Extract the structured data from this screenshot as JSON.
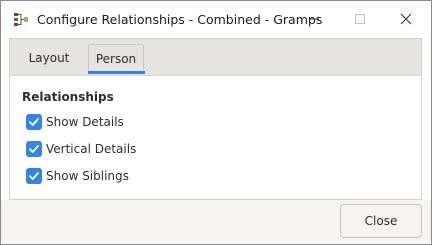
{
  "window": {
    "title": "Configure Relationships - Combined - Gramps",
    "app_icon": "gramps-tree-icon",
    "controls": {
      "minimize_icon": "minimize-icon",
      "maximize_icon": "maximize-icon",
      "close_icon": "close-icon"
    }
  },
  "tabs": [
    {
      "label": "Layout",
      "selected": false
    },
    {
      "label": "Person",
      "selected": true
    }
  ],
  "panel": {
    "section_title": "Relationships",
    "options": [
      {
        "label": "Show Details",
        "checked": true
      },
      {
        "label": "Vertical Details",
        "checked": true
      },
      {
        "label": "Show Siblings",
        "checked": true
      }
    ]
  },
  "footer": {
    "close_label": "Close"
  },
  "colors": {
    "accent": "#3584e4",
    "tabbar_bg": "#e6e4e1",
    "footer_bg": "#f6f5f4",
    "text": "#2e2e2e"
  }
}
